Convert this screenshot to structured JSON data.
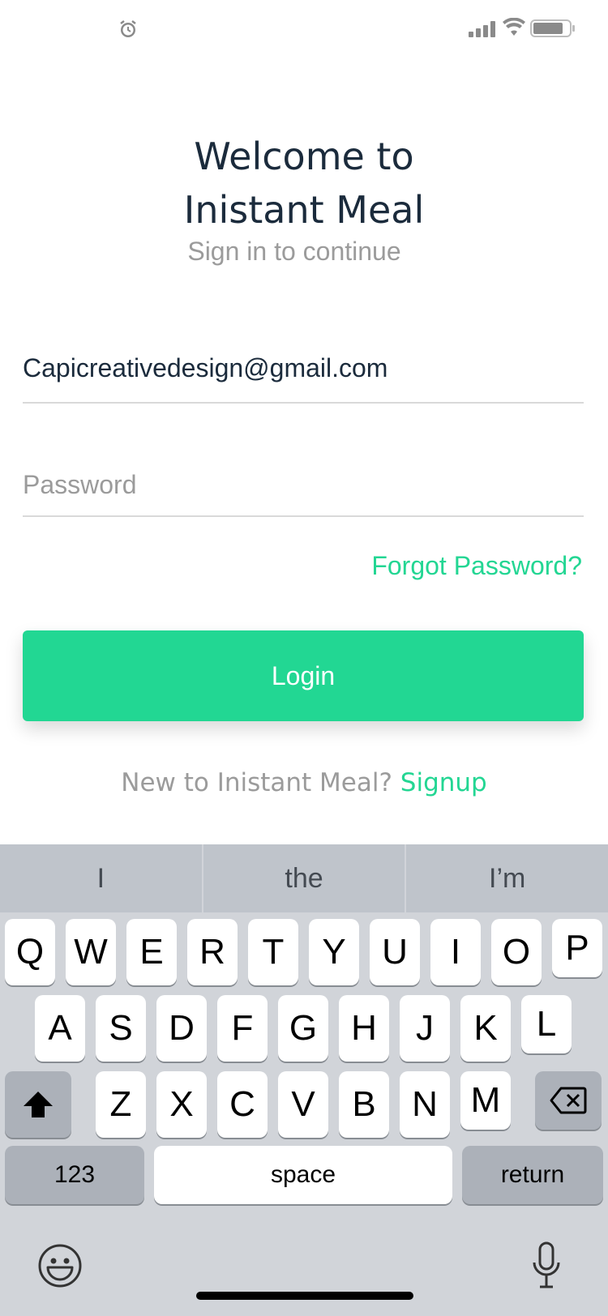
{
  "header": {
    "title_line1": "Welcome to",
    "title_line2": "Inistant Meal",
    "subtitle": "Sign in to continue"
  },
  "form": {
    "email_value": "Capicreativedesign@gmail.com",
    "password_placeholder": "Password",
    "forgot_label": "Forgot Password?",
    "login_label": "Login"
  },
  "signup": {
    "prompt": "New to Inistant Meal? ",
    "link": "Signup"
  },
  "keyboard": {
    "suggestions": [
      "I",
      "the",
      "I’m"
    ],
    "row1": [
      "Q",
      "W",
      "E",
      "R",
      "T",
      "Y",
      "U",
      "I",
      "O",
      "P"
    ],
    "row2": [
      "A",
      "S",
      "D",
      "F",
      "G",
      "H",
      "J",
      "K",
      "L"
    ],
    "row3": [
      "Z",
      "X",
      "C",
      "V",
      "B",
      "N",
      "M"
    ],
    "numbers_label": "123",
    "space_label": "space",
    "return_label": "return"
  },
  "colors": {
    "accent": "#22d793",
    "title": "#1b2b3c",
    "muted": "#9b9b9b"
  }
}
